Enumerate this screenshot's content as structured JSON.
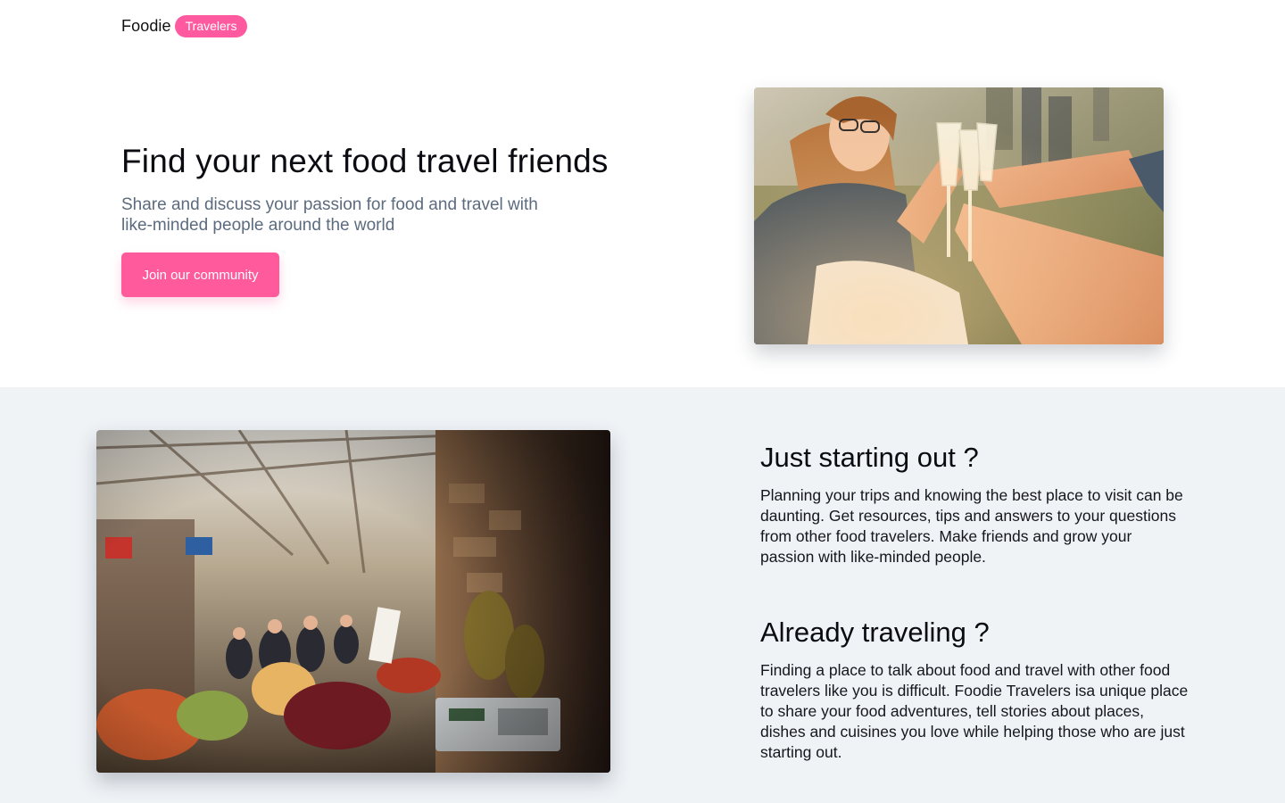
{
  "brand": {
    "name": "Foodie",
    "badge": "Travelers",
    "accent": "#ff5aa0"
  },
  "hero": {
    "title": "Find your next food travel friends",
    "subtitle": "Share and discuss your passion for food and travel with like-minded people around the world",
    "cta_label": "Join our community",
    "image_icon": "photo-friends-toasting-champagne"
  },
  "features": {
    "image_icon": "photo-outdoor-food-market",
    "items": [
      {
        "title": "Just starting out ?",
        "body": "Planning your trips and knowing the best place to visit can be daunting. Get resources, tips and answers to your questions from other food travelers. Make friends and grow your passion with like-minded people."
      },
      {
        "title": "Already traveling ?",
        "body": "Finding a place to talk about food and travel with other food travelers like you is difficult. Foodie Travelers isa unique place to share your food adventures, tell stories about places, dishes and cuisines you love while helping those who are just starting out."
      }
    ]
  }
}
